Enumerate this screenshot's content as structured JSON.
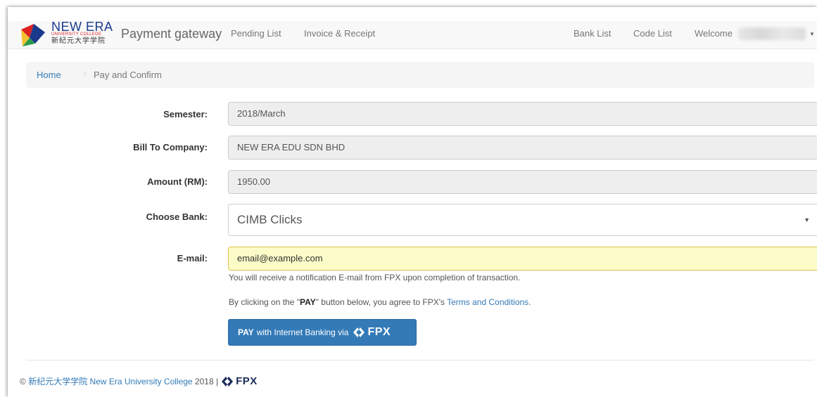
{
  "navbar": {
    "brand_en": "NEW ERA",
    "brand_sub": "UNIVERSITY COLLEGE",
    "brand_zh": "新纪元大学学院",
    "title": "Payment gateway",
    "links": [
      "Pending List",
      "Invoice & Receipt",
      "Bank List",
      "Code List"
    ],
    "welcome": "Welcome"
  },
  "breadcrumb": {
    "home": "Home",
    "current": "Pay and Confirm"
  },
  "form": {
    "semester_label": "Semester:",
    "semester_value": "2018/March",
    "company_label": "Bill To Company:",
    "company_value": "NEW ERA EDU SDN BHD",
    "amount_label": "Amount (RM):",
    "amount_value": "1950.00",
    "bank_label": "Choose Bank:",
    "bank_value": "CIMB Clicks",
    "email_label": "E-mail:",
    "email_value": "email@example.com",
    "notify_text": "You will receive a notification E-mail from FPX upon completion of transaction.",
    "agree_prefix": "By clicking on the \"",
    "agree_bold": "PAY",
    "agree_mid": "\" button below, you agree to FPX's ",
    "agree_link": "Terms and Conditions."
  },
  "pay_button": {
    "bold": "PAY",
    "text": "with Internet Banking via",
    "fpx": "FPX"
  },
  "footer": {
    "copyright": "©",
    "zh_name": "新纪元大学学院",
    "en_name": "New Era University College",
    "year_text": "2018 |",
    "fpx": "FPX"
  },
  "colors": {
    "primary": "#337ab7",
    "email_bg": "#fbfcc8",
    "brand_blue": "#1b3a8c",
    "brand_red": "#d22222"
  }
}
